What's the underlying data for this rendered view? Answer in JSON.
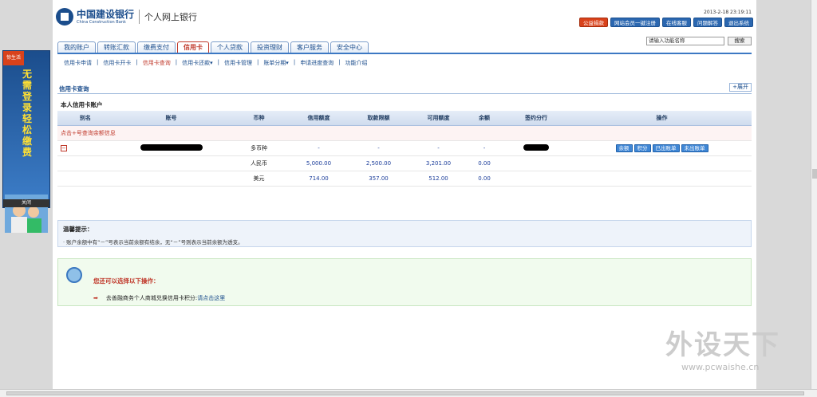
{
  "bank": {
    "name_cn": "中国建设银行",
    "name_en": "China Construction Bank",
    "section": "个人网上银行"
  },
  "datetime": "2013-2-18 23:19:11",
  "top_buttons": [
    {
      "label": "公益捐款",
      "accent": "red"
    },
    {
      "label": "网站会员一键注册"
    },
    {
      "label": "在线客服"
    },
    {
      "label": "问题解答"
    },
    {
      "label": "退出系统"
    }
  ],
  "tabs": [
    "我的账户",
    "转账汇款",
    "缴费支付",
    "信用卡",
    "个人贷款",
    "投资理财",
    "客户服务",
    "安全中心"
  ],
  "active_tab": "信用卡",
  "search": {
    "placeholder": "请输入功能名称",
    "button": "搜索"
  },
  "subnav": [
    "信用卡申请",
    "信用卡开卡",
    "信用卡查询",
    "信用卡还款▾",
    "信用卡管理",
    "账单分期▾",
    "申请进度查询",
    "功能介绍"
  ],
  "section": {
    "title": "信用卡查询",
    "expand": "+展开",
    "account_title": "本人信用卡账户"
  },
  "table": {
    "headers": [
      "别名",
      "账号",
      "币种",
      "信用额度",
      "取款限额",
      "可用额度",
      "余额",
      "签约分行",
      "操作"
    ],
    "hint": "点击+号查询余额信息",
    "rows": [
      {
        "currency": "多币种",
        "credit": "-",
        "withdraw": "-",
        "available": "-",
        "balance": "-"
      },
      {
        "currency": "人民币",
        "credit": "5,000.00",
        "withdraw": "2,500.00",
        "available": "3,201.00",
        "balance": "0.00"
      },
      {
        "currency": "美元",
        "credit": "714.00",
        "withdraw": "357.00",
        "available": "512.00",
        "balance": "0.00"
      }
    ],
    "action_buttons": [
      "余额",
      "积分",
      "已出账单",
      "未出账单"
    ]
  },
  "tips": {
    "title": "温馨提示：",
    "text": "· 账户余额中有“－”号表示当前余额有结余，无“－”号则表示当前余额为透支。"
  },
  "actions": {
    "title": "您还可以选择以下操作：",
    "line": "去善融商务个人商城兑换信用卡积分:",
    "link": "请点击这里"
  },
  "ad": {
    "badge": "惊生活",
    "text": "无需登录 轻松缴费",
    "close": "关闭"
  },
  "watermark": {
    "big": "外设天下",
    "url": "www.pcwaishe.cn"
  }
}
